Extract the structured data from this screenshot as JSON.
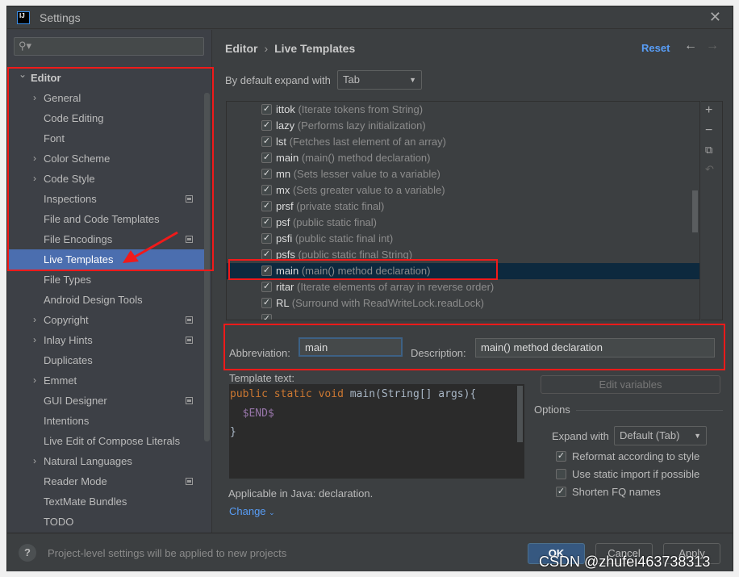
{
  "window": {
    "title": "Settings"
  },
  "sidebar": {
    "search_placeholder": "",
    "items": [
      {
        "label": "Editor",
        "expanded": true,
        "bold": true
      },
      {
        "label": "General",
        "chevron": true
      },
      {
        "label": "Code Editing"
      },
      {
        "label": "Font"
      },
      {
        "label": "Color Scheme",
        "chevron": true
      },
      {
        "label": "Code Style",
        "chevron": true
      },
      {
        "label": "Inspections",
        "project": true
      },
      {
        "label": "File and Code Templates"
      },
      {
        "label": "File Encodings",
        "project": true
      },
      {
        "label": "Live Templates",
        "selected": true
      },
      {
        "label": "File Types"
      },
      {
        "label": "Android Design Tools"
      },
      {
        "label": "Copyright",
        "chevron": true,
        "project": true
      },
      {
        "label": "Inlay Hints",
        "chevron": true,
        "project": true
      },
      {
        "label": "Duplicates"
      },
      {
        "label": "Emmet",
        "chevron": true
      },
      {
        "label": "GUI Designer",
        "project": true
      },
      {
        "label": "Intentions"
      },
      {
        "label": "Live Edit of Compose Literals"
      },
      {
        "label": "Natural Languages",
        "chevron": true
      },
      {
        "label": "Reader Mode",
        "project": true
      },
      {
        "label": "TextMate Bundles"
      },
      {
        "label": "TODO"
      }
    ]
  },
  "header": {
    "breadcrumb": [
      "Editor",
      "Live Templates"
    ],
    "reset": "Reset",
    "back_icon": "arrow-left",
    "forward_icon": "arrow-right"
  },
  "expand": {
    "label": "By default expand with",
    "value": "Tab"
  },
  "templates": [
    {
      "abbr": "ittok",
      "desc": "(Iterate tokens from String)",
      "checked": true
    },
    {
      "abbr": "lazy",
      "desc": "(Performs lazy initialization)",
      "checked": true
    },
    {
      "abbr": "lst",
      "desc": "(Fetches last element of an array)",
      "checked": true
    },
    {
      "abbr": "main",
      "desc": "(main() method declaration)",
      "checked": true
    },
    {
      "abbr": "mn",
      "desc": "(Sets lesser value to a variable)",
      "checked": true
    },
    {
      "abbr": "mx",
      "desc": "(Sets greater value to a variable)",
      "checked": true
    },
    {
      "abbr": "prsf",
      "desc": "(private static final)",
      "checked": true
    },
    {
      "abbr": "psf",
      "desc": "(public static final)",
      "checked": true
    },
    {
      "abbr": "psfi",
      "desc": "(public static final int)",
      "checked": true
    },
    {
      "abbr": "psfs",
      "desc": "(public static final String)",
      "checked": true
    },
    {
      "abbr": "main",
      "desc": "(main() method declaration)",
      "checked": true,
      "selected": true
    },
    {
      "abbr": "ritar",
      "desc": "(Iterate elements of array in reverse order)",
      "checked": true
    },
    {
      "abbr": "RL",
      "desc": "(Surround with ReadWriteLock.readLock)",
      "checked": true
    },
    {
      "abbr": "",
      "desc": "",
      "checked": true
    }
  ],
  "form": {
    "abbr_label": "Abbreviation:",
    "abbr_value": "main",
    "desc_label": "Description:",
    "desc_value": "main() method declaration",
    "template_label": "Template text:",
    "edit_variables": "Edit variables",
    "code": {
      "kw1": "public",
      "kw2": "static",
      "kw3": "void",
      "sig": "main(String[] args){",
      "var": "$END$",
      "close": "}"
    },
    "applicable": "Applicable in Java: declaration.",
    "change": "Change"
  },
  "options": {
    "title": "Options",
    "expand_label": "Expand with",
    "expand_value": "Default (Tab)",
    "reformat": {
      "label": "Reformat according to style",
      "checked": true
    },
    "static_import": {
      "label": "Use static import if possible",
      "checked": false
    },
    "shorten": {
      "label": "Shorten FQ names",
      "checked": true
    }
  },
  "footer": {
    "hint": "Project-level settings will be applied to new projects",
    "ok": "OK",
    "cancel": "Cancel",
    "apply": "Apply"
  },
  "watermark": "CSDN @zhufei463738313",
  "colors": {
    "accent": "#4b6eaf",
    "link": "#589df6",
    "annotation": "#f01a1a",
    "selected_row": "#0d293e"
  }
}
